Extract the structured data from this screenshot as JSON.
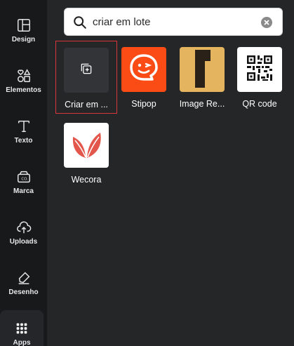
{
  "sidebar": {
    "items": [
      {
        "label": "Design",
        "icon": "layout-icon"
      },
      {
        "label": "Elementos",
        "icon": "shapes-icon"
      },
      {
        "label": "Texto",
        "icon": "text-icon"
      },
      {
        "label": "Marca",
        "icon": "brand-icon"
      },
      {
        "label": "Uploads",
        "icon": "cloud-upload-icon"
      },
      {
        "label": "Desenho",
        "icon": "pen-icon"
      },
      {
        "label": "Apps",
        "icon": "apps-grid-icon"
      }
    ]
  },
  "search": {
    "value": "criar em lote",
    "icon": "search-icon"
  },
  "results": [
    {
      "name": "Criar em ...",
      "icon": "bulk-create-icon",
      "bg": "#333438",
      "selected": true
    },
    {
      "name": "Stipop",
      "icon": "stipop-logo",
      "bg": "#fb4c16"
    },
    {
      "name": "Image Re...",
      "icon": "image-resize-logo",
      "bg": "#e4b45e"
    },
    {
      "name": "QR code",
      "icon": "qr-code-icon",
      "bg": "#ffffff"
    },
    {
      "name": "Wecora",
      "icon": "wecora-logo",
      "bg": "#ffffff"
    }
  ],
  "colors": {
    "sidebar_bg": "#18191b",
    "panel_bg": "#252627",
    "selected_border": "#d9363e",
    "stipop": "#fb4c16",
    "image_resize": "#e4b45e",
    "wecora": "#e2564b"
  }
}
